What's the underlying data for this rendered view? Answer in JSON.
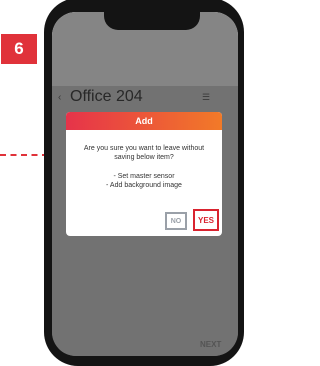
{
  "step_number": "6",
  "tabs": [
    "",
    "",
    "",
    "",
    ""
  ],
  "room": {
    "title": "Office 204",
    "subtitle": ""
  },
  "footer": {
    "next_label": "NEXT"
  },
  "dialog": {
    "title": "Add",
    "message": "Are you sure you want to leave without saving below item?",
    "items": [
      "- Set master sensor",
      "- Add background image"
    ],
    "no_label": "NO",
    "yes_label": "YES"
  },
  "colors": {
    "badge": "#e0323a",
    "header_gradient_start": "#e6334a",
    "header_gradient_end": "#f27a28",
    "yes_highlight": "#d9232f",
    "no_highlight": "#9aa0a8"
  },
  "icons": {
    "back": "chevron-left-icon",
    "menu": "menu-icon"
  }
}
